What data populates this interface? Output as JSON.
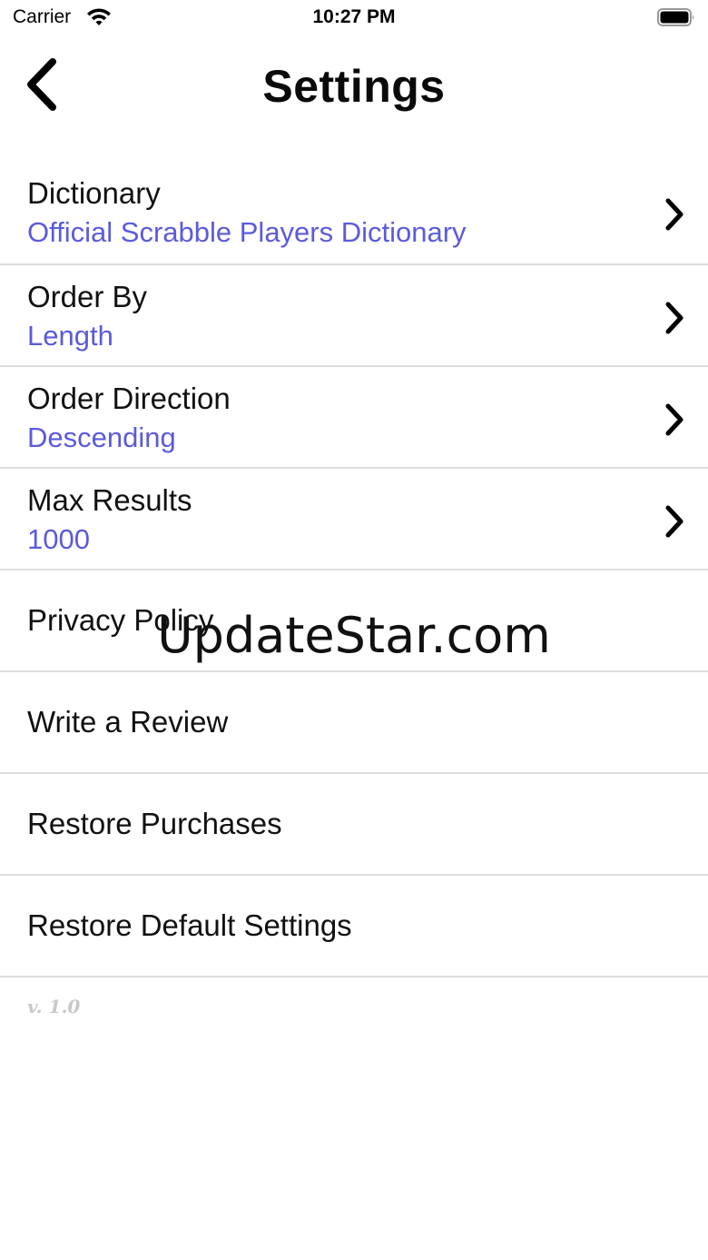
{
  "status_bar": {
    "carrier": "Carrier",
    "time": "10:27 PM",
    "wifi_icon": "wifi-icon",
    "battery_icon": "battery-icon"
  },
  "nav": {
    "back_icon": "chevron-left-icon",
    "title": "Settings"
  },
  "accent_color": "#5b5bdc",
  "rows": [
    {
      "title": "Dictionary",
      "value": "Official Scrabble Players Dictionary",
      "has_chevron": true
    },
    {
      "title": "Order By",
      "value": "Length",
      "has_chevron": true
    },
    {
      "title": "Order Direction",
      "value": "Descending",
      "has_chevron": true
    },
    {
      "title": "Max Results",
      "value": "1000",
      "has_chevron": true
    },
    {
      "title": "Privacy Policy"
    },
    {
      "title": "Write a Review"
    },
    {
      "title": "Restore Purchases"
    },
    {
      "title": "Restore Default Settings"
    }
  ],
  "version": "v. 1.0",
  "watermark": "UpdateStar.com"
}
